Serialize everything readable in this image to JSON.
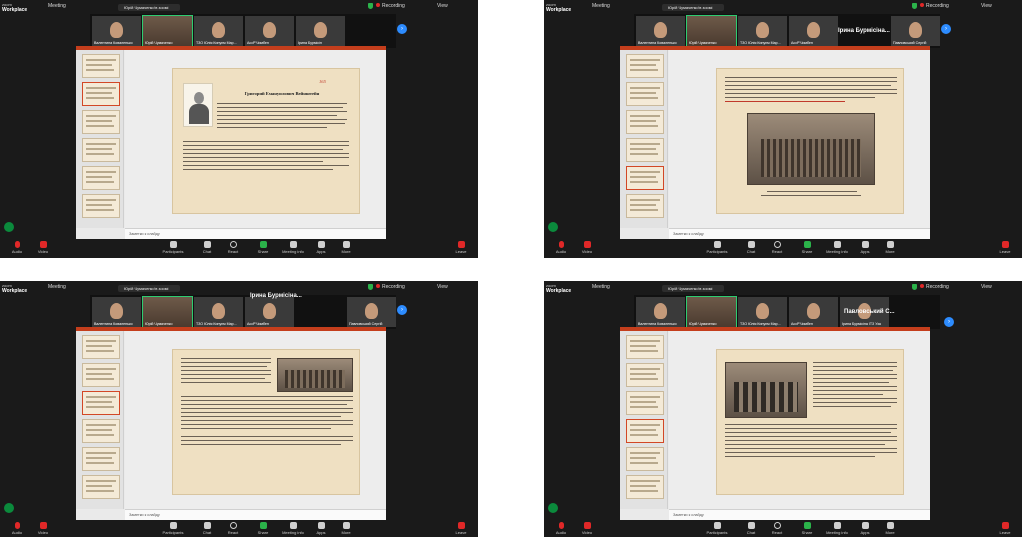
{
  "windows": [
    {
      "app": {
        "brand": "Workplace",
        "brand_sub": "zoom",
        "meeting_label": "Meeting",
        "recording_label": "Recording",
        "view_label": "View"
      },
      "speaker": "Юрій Чумаченко'в зоомі",
      "big_name": "",
      "participants": [
        "Валентина Коваленько",
        "Юрій Чумаченко",
        "ТЗО Юлія Кинуєм Мар...",
        "AccP'Чимбен",
        "Ірина Бурмісін"
      ],
      "slide": {
        "page": "165",
        "title": "Григорий Емануилович Вейнштейн",
        "layout": "portrait-text"
      },
      "notes_placeholder": "Заметки к слайду",
      "toolbar": [
        "Audio",
        "Video",
        "Participants",
        "Chat",
        "React",
        "Share",
        "Meeting info",
        "Apps",
        "More",
        "Leave"
      ]
    },
    {
      "app": {
        "brand": "Workplace",
        "brand_sub": "zoom",
        "meeting_label": "Meeting",
        "recording_label": "Recording",
        "view_label": "View"
      },
      "speaker": "Юрій Чумаченко'в зоомі",
      "big_name": "Ірина Бурмісіна...",
      "participants": [
        "Валентина Коваленько",
        "Юрій Чумаченко",
        "ТЗО Юлія Кинуєм Мар...",
        "AccP'Чимбен",
        "Ірина Бурмісіна ІТЗ Уза",
        "Павловський Сергій"
      ],
      "slide": {
        "page": "",
        "title": "",
        "layout": "text-photo"
      },
      "notes_placeholder": "Заметки к слайду",
      "toolbar": [
        "Audio",
        "Video",
        "Participants",
        "Chat",
        "React",
        "Share",
        "Meeting info",
        "Apps",
        "More",
        "Leave"
      ]
    },
    {
      "app": {
        "brand": "Workplace",
        "brand_sub": "zoom",
        "meeting_label": "Meeting",
        "recording_label": "Recording",
        "view_label": "View"
      },
      "speaker": "Юрій Чумаченко'в зоомі",
      "big_name": "Ірина Бурмісіна...",
      "participants": [
        "Валентина Коваленько",
        "Юрій Чумаченко",
        "ТЗО Юлія Кинуєм Мар...",
        "AccP'Чимбен",
        "Павловський Сергій"
      ],
      "slide": {
        "page": "",
        "title": "",
        "layout": "text-with-photo"
      },
      "notes_placeholder": "Заметки к слайду",
      "toolbar": [
        "Audio",
        "Video",
        "Participants",
        "Chat",
        "React",
        "Share",
        "Meeting info",
        "Apps",
        "More",
        "Leave"
      ]
    },
    {
      "app": {
        "brand": "Workplace",
        "brand_sub": "zoom",
        "meeting_label": "Meeting",
        "recording_label": "Recording",
        "view_label": "View"
      },
      "speaker": "Юрій Чумаченко'в зоомі",
      "big_name": "Павловський С...",
      "participants": [
        "Валентина Коваленько",
        "Юрій Чумаченко",
        "ТЗО Юлія Кинуєм Мар...",
        "AccP'Чимбен",
        "Ірина Бурмісіна ІТЗ Уза",
        "Павловський Сергій"
      ],
      "slide": {
        "page": "",
        "title": "",
        "layout": "photo-text"
      },
      "notes_placeholder": "Заметки к слайду",
      "toolbar": [
        "Audio",
        "Video",
        "Participants",
        "Chat",
        "React",
        "Share",
        "Meeting info",
        "Apps",
        "More",
        "Leave"
      ]
    }
  ],
  "colors": {
    "recording": "#e02828",
    "share": "#2bb34a",
    "accent": "#2d8cff",
    "ppt_ribbon": "#c43e1c"
  }
}
